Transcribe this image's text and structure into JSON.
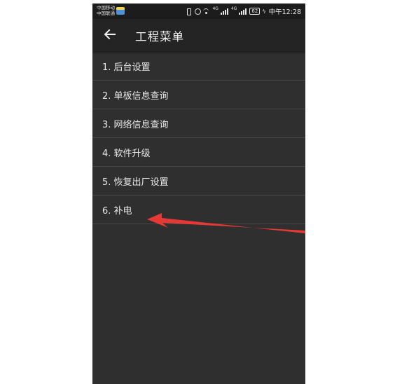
{
  "status_bar": {
    "carrier_1": "中国移动",
    "carrier_2": "中国联通",
    "network_1": "4G",
    "network_2": "4G",
    "battery": "62",
    "time": "中午12:28"
  },
  "app_bar": {
    "title": "工程菜单",
    "back_icon": "arrow-left-icon"
  },
  "menu": {
    "items": [
      {
        "label": "1. 后台设置"
      },
      {
        "label": "2. 单板信息查询"
      },
      {
        "label": "3. 网络信息查询"
      },
      {
        "label": "4. 软件升级"
      },
      {
        "label": "5. 恢复出厂设置"
      },
      {
        "label": "6. 补电"
      }
    ]
  },
  "annotation": {
    "arrow_color": "#e53935"
  },
  "colors": {
    "background": "#2f2f2f",
    "app_bar": "#242424",
    "status_bar": "#1c1c1c",
    "divider": "#474747",
    "text": "#e8e8e8"
  }
}
